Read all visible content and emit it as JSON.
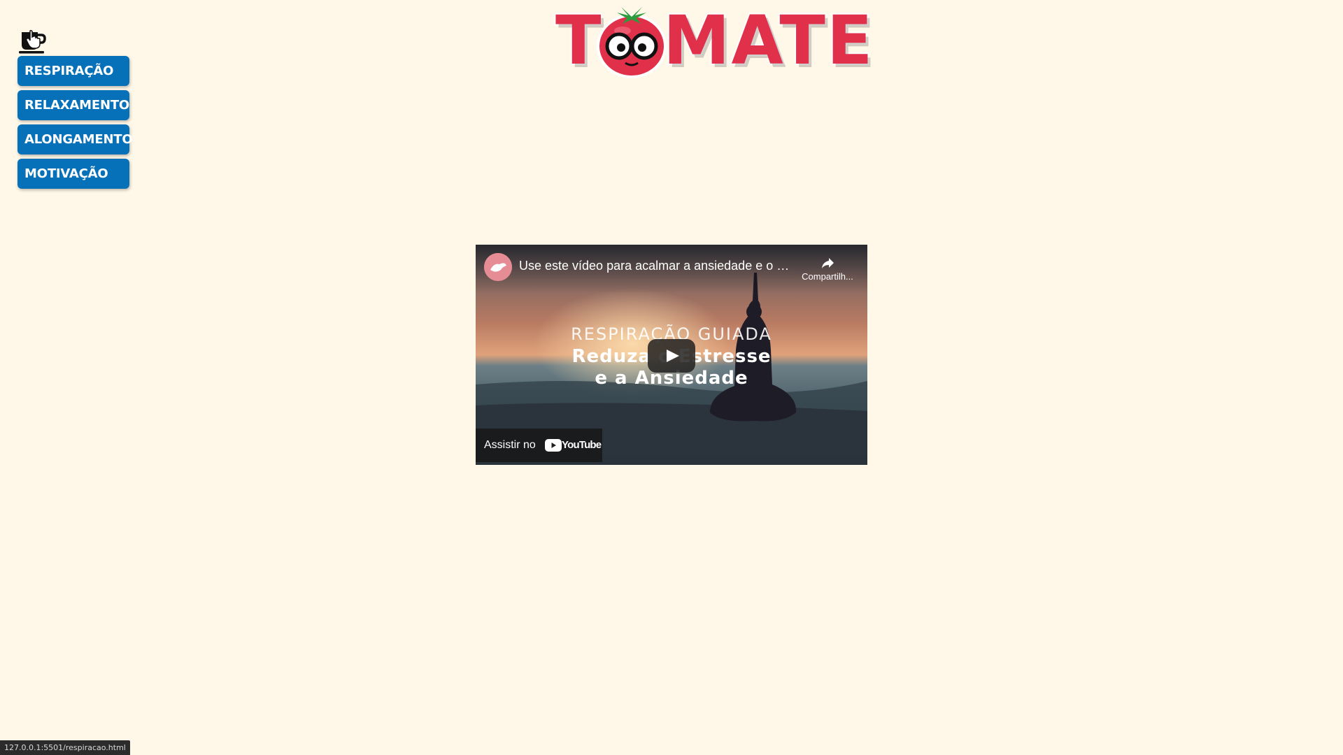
{
  "logo": {
    "letter_t": "T",
    "letters_mate": "MATE",
    "brand_color": "#e0304a"
  },
  "coffee_button": {
    "icon": "coffee-cup-icon"
  },
  "nav": {
    "items": [
      {
        "label": "RESPIRAÇÃO"
      },
      {
        "label": "RELAXAMENTO"
      },
      {
        "label": "ALONGAMENTO"
      },
      {
        "label": "MOTIVAÇÃO"
      }
    ],
    "button_color": "#0671b8"
  },
  "video": {
    "title": "Use este vídeo para acalmar a ansiedade e o estresse",
    "share_label": "Compartilh...",
    "overlay_small": "RESPIRAÇÃO GUIADA",
    "overlay_line1": "Reduza o Estresse",
    "overlay_line2": "e a Ansiedade",
    "watch_on_label": "Assistir no",
    "youtube_word": "YouTube"
  },
  "status_bar": {
    "url": "127.0.0.1:5501/respiracao.html"
  },
  "background_color": "#fff8e9"
}
